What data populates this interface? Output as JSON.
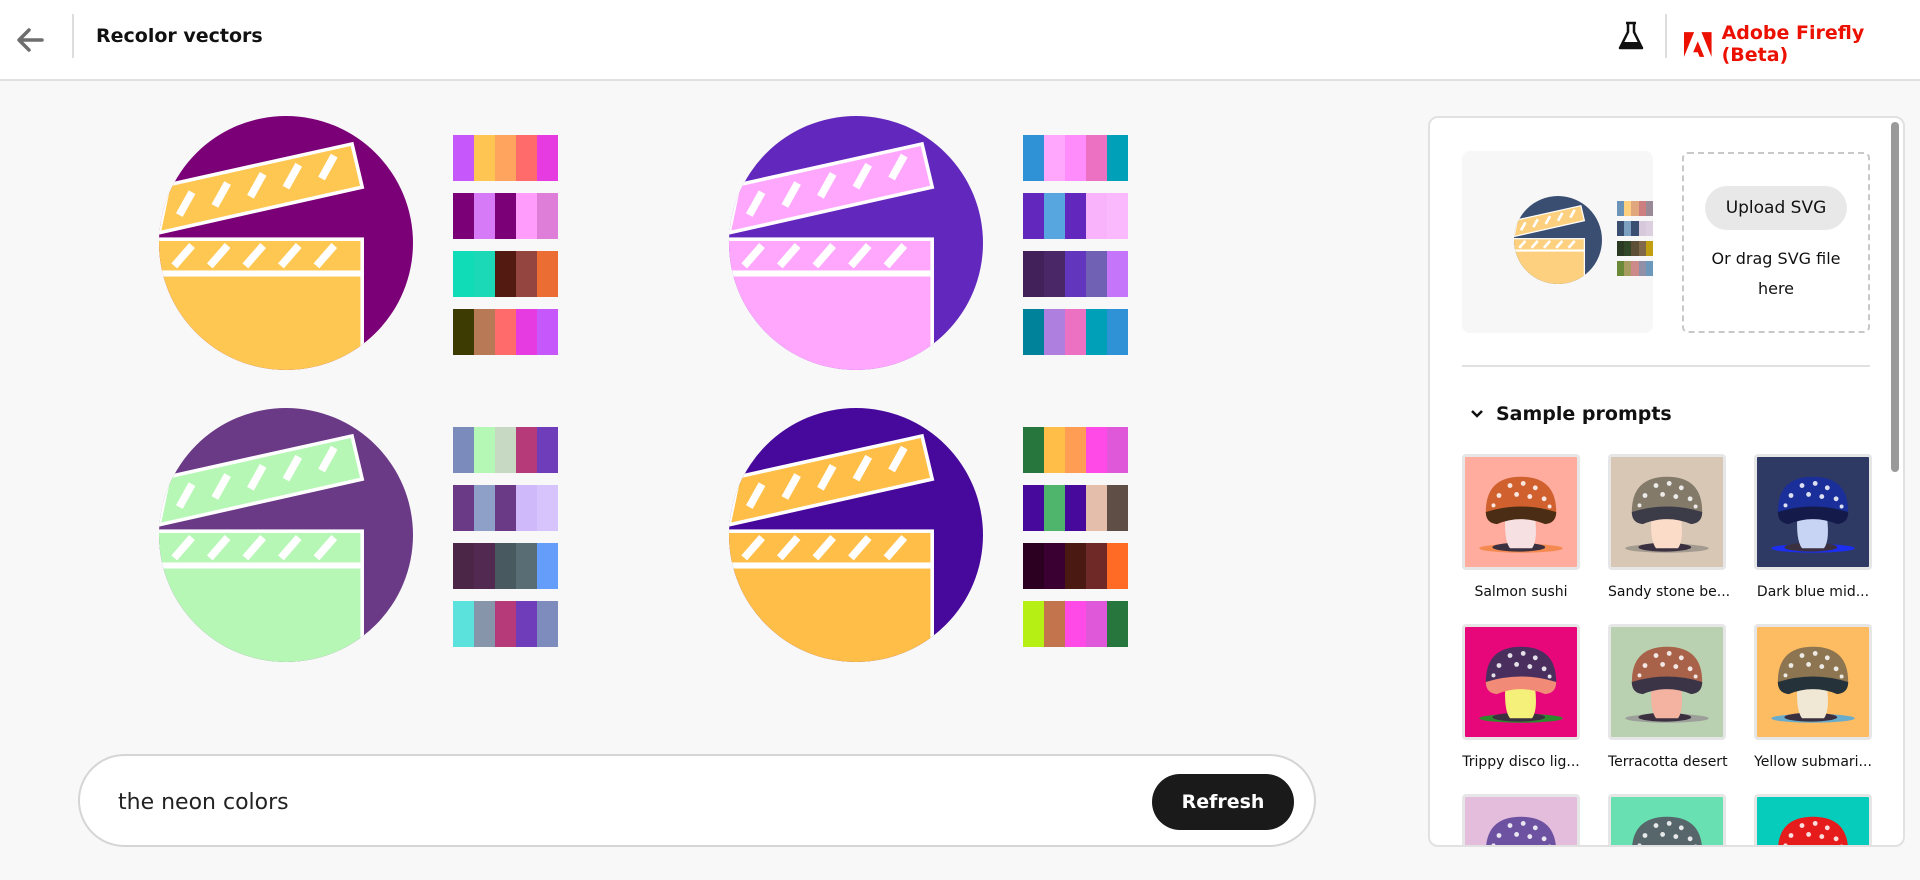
{
  "header": {
    "title": "Recolor vectors",
    "brand": "Adobe Firefly (Beta)",
    "brand_color": "#eb1000",
    "icons": [
      "back-arrow-icon",
      "flask-icon",
      "adobe-logo-icon"
    ]
  },
  "results": [
    {
      "dark": "#7b0077",
      "light": "#fec752",
      "palettes": [
        [
          "#c657fb",
          "#ffc552",
          "#ffa45f",
          "#ff6b6b",
          "#e53be0"
        ],
        [
          "#7b0077",
          "#d77af8",
          "#7b0077",
          "#ff9cfc",
          "#de7ed9"
        ],
        [
          "#10dcb8",
          "#1bd9b6",
          "#521a10",
          "#954540",
          "#ec6d33"
        ],
        [
          "#3d3a02",
          "#b87956",
          "#ff6b6b",
          "#e53be0",
          "#c657fb"
        ]
      ]
    },
    {
      "dark": "#6228bd",
      "light": "#ffa7fd",
      "palettes": [
        [
          "#3092d6",
          "#ffa7fd",
          "#ff8cfb",
          "#ec71c2",
          "#00a0b8"
        ],
        [
          "#6228bd",
          "#58a6df",
          "#6228bd",
          "#f8b3fb",
          "#fab9fd"
        ],
        [
          "#42215a",
          "#4a2766",
          "#6236bd",
          "#7161b5",
          "#c475f9"
        ],
        [
          "#00839a",
          "#ae7fdf",
          "#ec71c2",
          "#00a0b8",
          "#3092d6"
        ]
      ]
    },
    {
      "dark": "#6a3a86",
      "light": "#b6f7b5",
      "palettes": [
        [
          "#7b8bbb",
          "#b5f8b5",
          "#c7d9c3",
          "#b63a7a",
          "#703dba"
        ],
        [
          "#6a3a86",
          "#8fa0c8",
          "#6a3a86",
          "#cfb9fb",
          "#d7c4fd"
        ],
        [
          "#4b2647",
          "#522951",
          "#485960",
          "#586d74",
          "#659dfa"
        ],
        [
          "#5be2dc",
          "#8795ab",
          "#b63a7a",
          "#703dba",
          "#7d8bbd"
        ]
      ]
    },
    {
      "dark": "#47099b",
      "light": "#ffbe47",
      "palettes": [
        [
          "#26763e",
          "#ffbe47",
          "#ff9d55",
          "#ff4ae8",
          "#e058da"
        ],
        [
          "#47099b",
          "#4fb56c",
          "#47099b",
          "#e5bdab",
          "#5f4e45"
        ],
        [
          "#2c0020",
          "#3a0031",
          "#4a1a12",
          "#6f2a28",
          "#ff6b25"
        ],
        [
          "#b6ef14",
          "#c4744c",
          "#ff4ae8",
          "#e058da",
          "#26763e"
        ]
      ]
    }
  ],
  "prompt": {
    "value": "the neon colors",
    "refresh_label": "Refresh"
  },
  "panel": {
    "preview": {
      "dark": "#3a4e72",
      "light": "#fcd07e",
      "palettes": [
        [
          "#6c93b8",
          "#fcd07e",
          "#e0a67e",
          "#cc7f7e",
          "#9a8a98"
        ],
        [
          "#3a4e72",
          "#7ea0c0",
          "#3a4e72",
          "#d8c8dc",
          "#dcd0e0"
        ],
        [
          "#2a3a22",
          "#304828",
          "#5e5036",
          "#80684a",
          "#c0a010"
        ],
        [
          "#6a8a3a",
          "#a89c60",
          "#cc8a8a",
          "#9090a8",
          "#6c98bc"
        ]
      ]
    },
    "upload_label": "Upload SVG",
    "drag_text": "Or drag SVG file here",
    "sample_prompts_title": "Sample prompts",
    "samples": [
      {
        "label": "Salmon sushi",
        "bg": "#ffab9e",
        "cap": "#d0612f",
        "under": "#4a2d14",
        "stem": "#f6e0e2",
        "shadow": "#f48a4f"
      },
      {
        "label": "Sandy stone be...",
        "bg": "#d8c7b4",
        "cap": "#837a6a",
        "under": "#3c3b48",
        "stem": "#fadcc8",
        "shadow": "#a49b90"
      },
      {
        "label": "Dark blue mid...",
        "bg": "#2f3a64",
        "cap": "#1a2f9a",
        "under": "#141b4a",
        "stem": "#c8d4f4",
        "shadow": "#1c2ef0"
      },
      {
        "label": "Trippy disco lig...",
        "bg": "#e8077a",
        "cap": "#4a2f5e",
        "under": "#f28a78",
        "stem": "#f4f07a",
        "shadow": "#2c8a2c"
      },
      {
        "label": "Terracotta desert",
        "bg": "#b9d1b0",
        "cap": "#a9624a",
        "under": "#3b3447",
        "stem": "#f4b2a0",
        "shadow": "#9c9f9a"
      },
      {
        "label": "Yellow submari...",
        "bg": "#fdbc62",
        "cap": "#8c7550",
        "under": "#26323a",
        "stem": "#f0e8d4",
        "shadow": "#6aaccc"
      },
      {
        "label": "",
        "bg": "#e4bcdc",
        "cap": "#6c52a0",
        "under": "#2a1f3a",
        "stem": "#eee",
        "shadow": "#999"
      },
      {
        "label": "",
        "bg": "#68e0b2",
        "cap": "#56666a",
        "under": "#1f2a30",
        "stem": "#eee",
        "shadow": "#999"
      },
      {
        "label": "",
        "bg": "#06ccbc",
        "cap": "#e61c1c",
        "under": "#1a1a2a",
        "stem": "#eee",
        "shadow": "#999"
      }
    ]
  }
}
